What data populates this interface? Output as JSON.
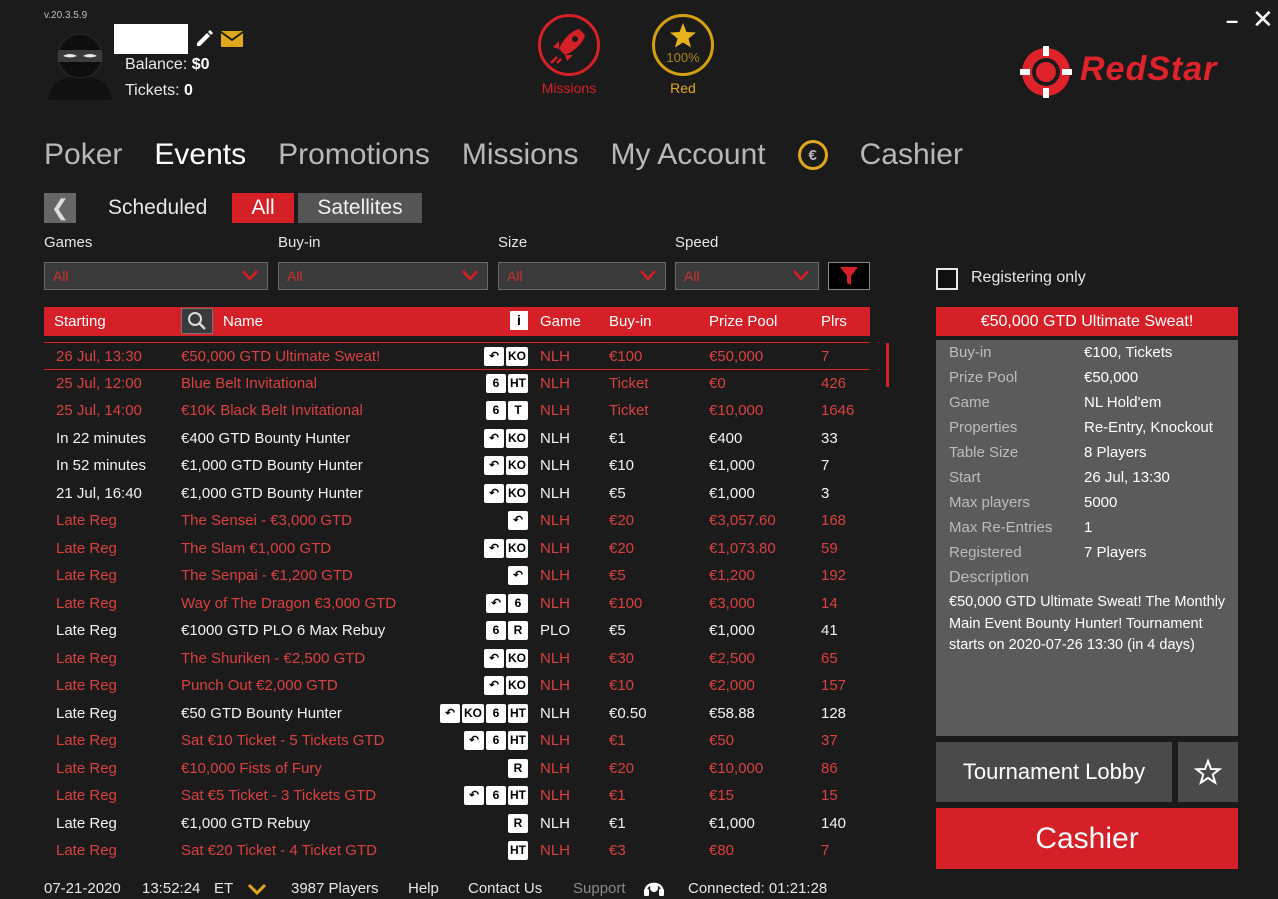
{
  "header": {
    "version": "v.20.3.5.9",
    "balance_label": "Balance:",
    "balance_value": "$0",
    "tickets_label": "Tickets:",
    "tickets_value": "0",
    "missions_label": "Missions",
    "rank_label": "Red",
    "rank_progress": "100%",
    "logo_text": "RedStar",
    "minimize": "–",
    "close": "✕"
  },
  "nav": {
    "poker": "Poker",
    "events": "Events",
    "promotions": "Promotions",
    "missions": "Missions",
    "my_account": "My Account",
    "cashier": "Cashier"
  },
  "subtabs": {
    "back": "❮",
    "scheduled": "Scheduled",
    "all": "All",
    "satellites": "Satellites"
  },
  "filters": {
    "games_label": "Games",
    "buyin_label": "Buy-in",
    "size_label": "Size",
    "speed_label": "Speed",
    "games_value": "All",
    "buyin_value": "All",
    "size_value": "All",
    "speed_value": "All"
  },
  "table": {
    "headers": {
      "starting": "Starting",
      "name": "Name",
      "info": "i",
      "game": "Game",
      "buyin": "Buy-in",
      "prize": "Prize Pool",
      "plrs": "Plrs"
    },
    "rows": [
      {
        "start": "26 Jul, 13:30",
        "name": "€50,000 GTD Ultimate Sweat!",
        "badges": [
          "↶",
          "KO"
        ],
        "game": "NLH",
        "buyin": "€100",
        "prize": "€50,000",
        "plrs": "7",
        "color": "red"
      },
      {
        "start": "25 Jul, 12:00",
        "name": "Blue Belt Invitational",
        "badges": [
          "6",
          "HT"
        ],
        "game": "NLH",
        "buyin": "Ticket",
        "prize": "€0",
        "plrs": "426",
        "color": "red"
      },
      {
        "start": "25 Jul, 14:00",
        "name": "€10K Black Belt Invitational",
        "badges": [
          "6",
          "T"
        ],
        "game": "NLH",
        "buyin": "Ticket",
        "prize": "€10,000",
        "plrs": "1646",
        "color": "red"
      },
      {
        "start": "In 22 minutes",
        "name": "€400 GTD Bounty Hunter",
        "badges": [
          "↶",
          "KO"
        ],
        "game": "NLH",
        "buyin": "€1",
        "prize": "€400",
        "plrs": "33",
        "color": "white"
      },
      {
        "start": "In 52 minutes",
        "name": "€1,000 GTD Bounty Hunter",
        "badges": [
          "↶",
          "KO"
        ],
        "game": "NLH",
        "buyin": "€10",
        "prize": "€1,000",
        "plrs": "7",
        "color": "white"
      },
      {
        "start": "21 Jul, 16:40",
        "name": "€1,000 GTD Bounty Hunter",
        "badges": [
          "↶",
          "KO"
        ],
        "game": "NLH",
        "buyin": "€5",
        "prize": "€1,000",
        "plrs": "3",
        "color": "white"
      },
      {
        "start": "Late Reg",
        "name": "The Sensei - €3,000 GTD",
        "badges": [
          "↶"
        ],
        "game": "NLH",
        "buyin": "€20",
        "prize": "€3,057.60",
        "plrs": "168",
        "color": "red"
      },
      {
        "start": "Late Reg",
        "name": "The Slam €1,000 GTD",
        "badges": [
          "↶",
          "KO"
        ],
        "game": "NLH",
        "buyin": "€20",
        "prize": "€1,073.80",
        "plrs": "59",
        "color": "red"
      },
      {
        "start": "Late Reg",
        "name": "The Senpai - €1,200 GTD",
        "badges": [
          "↶"
        ],
        "game": "NLH",
        "buyin": "€5",
        "prize": "€1,200",
        "plrs": "192",
        "color": "red"
      },
      {
        "start": "Late Reg",
        "name": "Way of The Dragon €3,000 GTD",
        "badges": [
          "↶",
          "6"
        ],
        "game": "NLH",
        "buyin": "€100",
        "prize": "€3,000",
        "plrs": "14",
        "color": "red"
      },
      {
        "start": "Late Reg",
        "name": "€1000 GTD PLO 6 Max Rebuy",
        "badges": [
          "6",
          "R"
        ],
        "game": "PLO",
        "buyin": "€5",
        "prize": "€1,000",
        "plrs": "41",
        "color": "white"
      },
      {
        "start": "Late Reg",
        "name": "The Shuriken - €2,500 GTD",
        "badges": [
          "↶",
          "KO"
        ],
        "game": "NLH",
        "buyin": "€30",
        "prize": "€2,500",
        "plrs": "65",
        "color": "red"
      },
      {
        "start": "Late Reg",
        "name": "Punch Out €2,000 GTD",
        "badges": [
          "↶",
          "KO"
        ],
        "game": "NLH",
        "buyin": "€10",
        "prize": "€2,000",
        "plrs": "157",
        "color": "red"
      },
      {
        "start": "Late Reg",
        "name": "€50 GTD Bounty Hunter",
        "badges": [
          "↶",
          "KO",
          "6",
          "HT"
        ],
        "game": "NLH",
        "buyin": "€0.50",
        "prize": "€58.88",
        "plrs": "128",
        "color": "white"
      },
      {
        "start": "Late Reg",
        "name": "Sat €10 Ticket - 5 Tickets GTD",
        "badges": [
          "↶",
          "6",
          "HT"
        ],
        "game": "NLH",
        "buyin": "€1",
        "prize": "€50",
        "plrs": "37",
        "color": "red"
      },
      {
        "start": "Late Reg",
        "name": "€10,000 Fists of Fury",
        "badges": [
          "R"
        ],
        "game": "NLH",
        "buyin": "€20",
        "prize": "€10,000",
        "plrs": "86",
        "color": "red"
      },
      {
        "start": "Late Reg",
        "name": "Sat €5 Ticket - 3 Tickets GTD",
        "badges": [
          "↶",
          "6",
          "HT"
        ],
        "game": "NLH",
        "buyin": "€1",
        "prize": "€15",
        "plrs": "15",
        "color": "red"
      },
      {
        "start": "Late Reg",
        "name": "€1,000 GTD Rebuy",
        "badges": [
          "R"
        ],
        "game": "NLH",
        "buyin": "€1",
        "prize": "€1,000",
        "plrs": "140",
        "color": "white"
      },
      {
        "start": "Late Reg",
        "name": "Sat €20 Ticket - 4 Ticket GTD",
        "badges": [
          "HT"
        ],
        "game": "NLH",
        "buyin": "€3",
        "prize": "€80",
        "plrs": "7",
        "color": "red"
      }
    ]
  },
  "details": {
    "registering_only": "Registering only",
    "title": "€50,000 GTD Ultimate Sweat!",
    "rows": [
      {
        "k": "Buy-in",
        "v": "€100, Tickets"
      },
      {
        "k": "Prize Pool",
        "v": "€50,000"
      },
      {
        "k": "Game",
        "v": "NL Hold'em"
      },
      {
        "k": "Properties",
        "v": "Re-Entry, Knockout"
      },
      {
        "k": "Table Size",
        "v": "8 Players"
      },
      {
        "k": "Start",
        "v": "26 Jul, 13:30"
      },
      {
        "k": "Max players",
        "v": "5000"
      },
      {
        "k": "Max Re-Entries",
        "v": "1"
      },
      {
        "k": "Registered",
        "v": "7 Players"
      }
    ],
    "description_label": "Description",
    "description": "€50,000 GTD Ultimate Sweat! The Monthly Main Event Bounty Hunter! Tournament starts on 2020-07-26 13:30 (in 4 days)",
    "lobby_button": "Tournament Lobby",
    "cashier_button": "Cashier"
  },
  "footer": {
    "date": "07-21-2020",
    "time": "13:52:24",
    "tz": "ET",
    "players": "3987 Players",
    "help": "Help",
    "contact": "Contact Us",
    "support": "Support",
    "connected": "Connected: 01:21:28"
  },
  "colors": {
    "accent_red": "#d62027",
    "gold": "#e0a81c",
    "background": "#1b1b1b",
    "panel": "#5b5b5b"
  }
}
